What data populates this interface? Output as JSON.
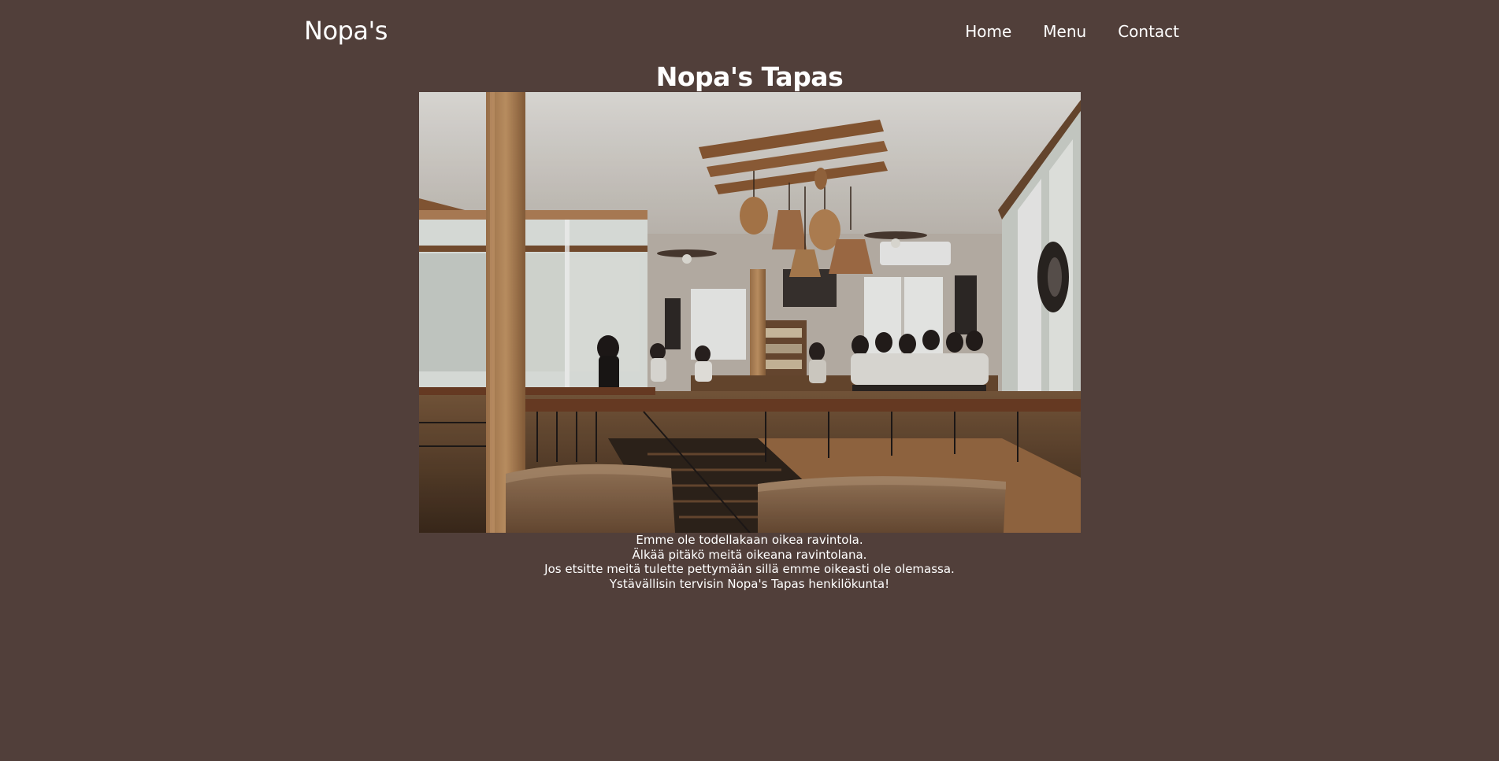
{
  "header": {
    "brand": "Nopa's",
    "nav": [
      {
        "label": "Home"
      },
      {
        "label": "Menu"
      },
      {
        "label": "Contact"
      }
    ]
  },
  "main": {
    "title": "Nopa's Tapas",
    "description_lines": [
      "Emme ole todellakaan oikea ravintola.",
      "Älkää pitäkö meitä oikeana ravintolana.",
      "Jos etsitte meitä tulette pettymään sillä emme oikeasti ole olemassa.",
      "Ystävällisin tervisin Nopa's Tapas henkilökunta!"
    ]
  },
  "colors": {
    "page_background": "#513f3a",
    "text": "#ffffff"
  }
}
